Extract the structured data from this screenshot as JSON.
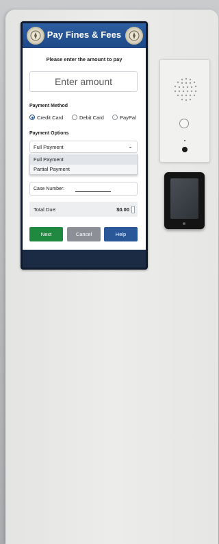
{
  "header": {
    "title": "Pay Fines & Fees"
  },
  "form": {
    "prompt": "Please enter the amount to pay",
    "amount_placeholder": "Enter amount",
    "payment_method_label": "Payment Method",
    "payment_methods": [
      {
        "label": "Credit Card",
        "selected": true
      },
      {
        "label": "Debit Card",
        "selected": false
      },
      {
        "label": "PayPal",
        "selected": false
      }
    ],
    "payment_options_label": "Payment Options",
    "payment_option_selected": "Full Payment",
    "payment_option_list": [
      "Full Payment",
      "Partial Payment"
    ],
    "case_number_label": "Case Number:",
    "total_label": "Total Due:",
    "total_value": "$0.00"
  },
  "buttons": {
    "primary": "Next",
    "cancel": "Cancel",
    "help": "Help"
  },
  "colors": {
    "header": "#1d4886",
    "green_button": "#1f8a3f",
    "grey_button": "#8c9096",
    "blue_button": "#2a5797"
  }
}
